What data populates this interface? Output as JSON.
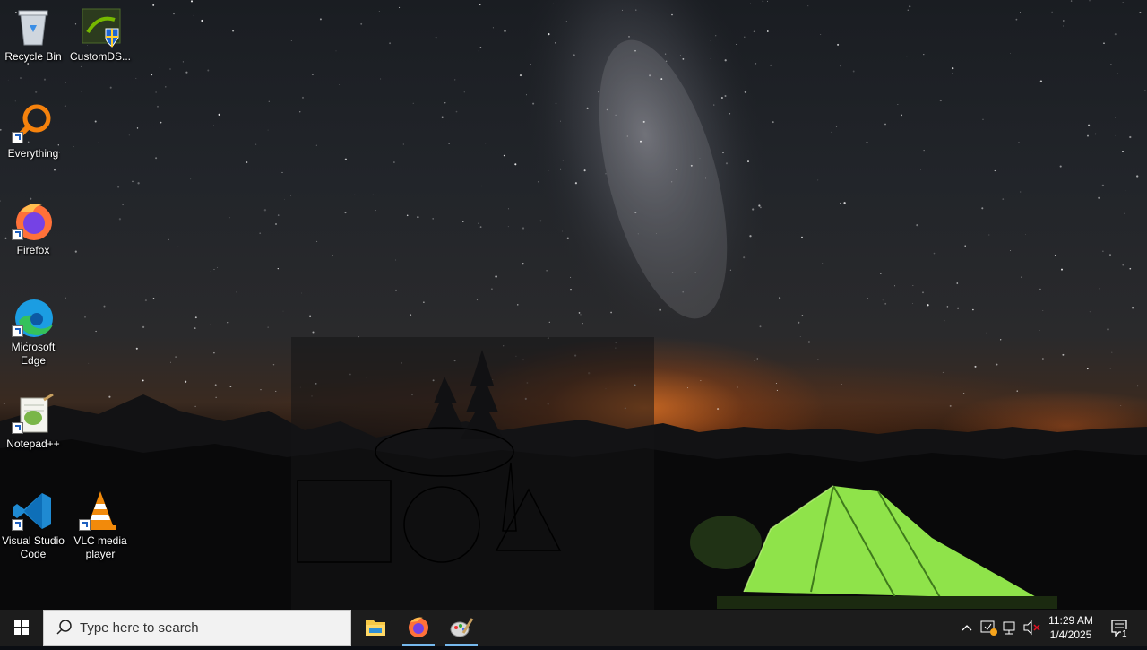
{
  "desktop": {
    "icons": [
      {
        "label": "Recycle Bin",
        "icon": "recycle-bin-icon"
      },
      {
        "label": "CustomDS...",
        "icon": "customds-icon"
      },
      {
        "label": "Everything",
        "icon": "everything-icon"
      },
      {
        "label": "Firefox",
        "icon": "firefox-icon"
      },
      {
        "label": "Microsoft Edge",
        "icon": "edge-icon"
      },
      {
        "label": "Notepad++",
        "icon": "notepadpp-icon"
      },
      {
        "label": "Visual Studio Code",
        "icon": "vscode-icon"
      },
      {
        "label": "VLC media player",
        "icon": "vlc-icon"
      }
    ]
  },
  "taskbar": {
    "search_placeholder": "Type here to search",
    "pinned": [
      {
        "name": "File Explorer",
        "icon": "file-explorer-icon"
      },
      {
        "name": "Firefox",
        "icon": "firefox-icon"
      },
      {
        "name": "Paint",
        "icon": "paint-icon"
      }
    ],
    "clock": {
      "time": "11:29 AM",
      "date": "1/4/2025"
    },
    "notification_count": "1"
  },
  "colors": {
    "taskbar": "#1c1c1c",
    "tent_green": "#8fe34a",
    "horizon_orange": "#d66e24"
  }
}
